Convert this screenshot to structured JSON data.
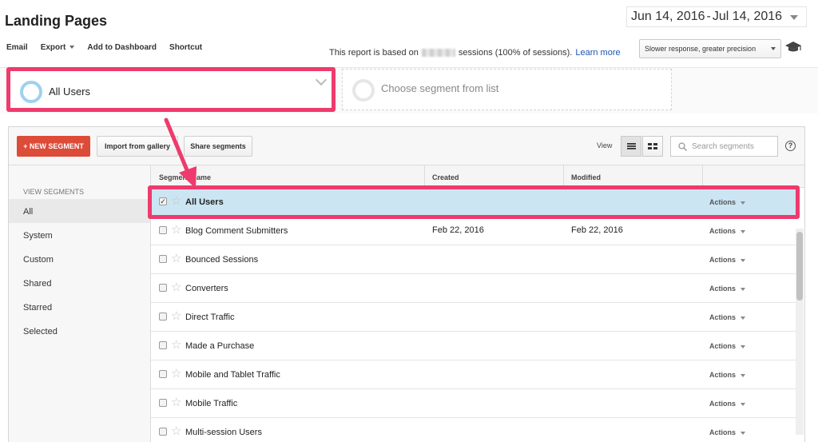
{
  "page": {
    "title": "Landing Pages",
    "date_start": "Jun 14, 2016",
    "date_sep": "-",
    "date_end": "Jul 14, 2016"
  },
  "toolbar": {
    "email": "Email",
    "export": "Export",
    "add_to_dashboard": "Add to Dashboard",
    "shortcut": "Shortcut"
  },
  "report_note": {
    "prefix": "This report is based on",
    "suffix": "sessions (100% of sessions).",
    "link": "Learn more"
  },
  "precision": {
    "selected": "Slower response, greater precision"
  },
  "segments_bar": {
    "active": "All Users",
    "placeholder": "Choose segment from list"
  },
  "panel": {
    "new_segment": "+ NEW SEGMENT",
    "import": "Import from gallery",
    "share": "Share segments",
    "view_label": "View",
    "search_placeholder": "Search segments",
    "help": "?"
  },
  "sidebar": {
    "heading": "VIEW SEGMENTS",
    "items": [
      "All",
      "System",
      "Custom",
      "Shared",
      "Starred",
      "Selected"
    ],
    "active_index": 0
  },
  "table": {
    "columns": {
      "name": "Segment Name",
      "created": "Created",
      "modified": "Modified"
    },
    "actions_label": "Actions",
    "rows": [
      {
        "name": "All Users",
        "created": "",
        "modified": "",
        "checked": true
      },
      {
        "name": "Blog Comment Submitters",
        "created": "Feb 22, 2016",
        "modified": "Feb 22, 2016",
        "checked": false
      },
      {
        "name": "Bounced Sessions",
        "created": "",
        "modified": "",
        "checked": false
      },
      {
        "name": "Converters",
        "created": "",
        "modified": "",
        "checked": false
      },
      {
        "name": "Direct Traffic",
        "created": "",
        "modified": "",
        "checked": false
      },
      {
        "name": "Made a Purchase",
        "created": "",
        "modified": "",
        "checked": false
      },
      {
        "name": "Mobile and Tablet Traffic",
        "created": "",
        "modified": "",
        "checked": false
      },
      {
        "name": "Mobile Traffic",
        "created": "",
        "modified": "",
        "checked": false
      },
      {
        "name": "Multi-session Users",
        "created": "",
        "modified": "",
        "checked": false
      }
    ]
  },
  "colors": {
    "highlight": "#ee3a6d",
    "new_segment_button": "#dd4b39",
    "selected_row": "#cbe5f3",
    "link": "#1a55b5"
  },
  "icons": {
    "date_caret": "chevron-down-icon",
    "precision_icon": "graduation-cap-icon",
    "search": "search-icon",
    "star": "star-icon",
    "list_view": "list-view-icon",
    "grid_view": "grid-view-icon"
  }
}
